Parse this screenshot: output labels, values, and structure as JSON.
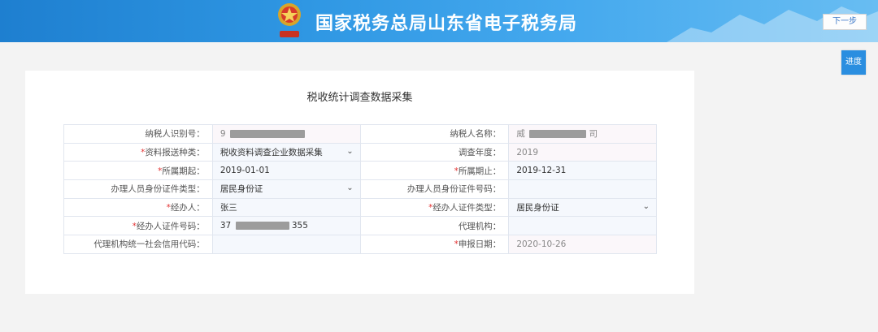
{
  "header": {
    "site_title": "国家税务总局山东省电子税务局",
    "next_label": "下一步"
  },
  "side": {
    "progress_label": "进度"
  },
  "form": {
    "title": "税收统计调查数据采集",
    "rows": [
      {
        "l1": "纳税人识别号：",
        "v1": "9",
        "l2": "纳税人名称：",
        "v2": "威",
        "v2_suffix": "司"
      },
      {
        "l1": "资料报送种类：",
        "v1": "税收资料调查企业数据采集",
        "l2": "调查年度：",
        "v2": "2019"
      },
      {
        "l1": "所属期起：",
        "v1": "2019-01-01",
        "l2": "所属期止：",
        "v2": "2019-12-31"
      },
      {
        "l1": "办理人员身份证件类型：",
        "v1": "居民身份证",
        "l2": "办理人员身份证件号码：",
        "v2": ""
      },
      {
        "l1": "经办人：",
        "v1": "张三",
        "l2": "经办人证件类型：",
        "v2": "居民身份证"
      },
      {
        "l1": "经办人证件号码：",
        "v1": "37",
        "v1_suffix": "355",
        "l2": "代理机构：",
        "v2": ""
      },
      {
        "l1": "代理机构统一社会信用代码：",
        "v1": "",
        "l2": "申报日期：",
        "v2": "2020-10-26"
      }
    ]
  },
  "icons": {
    "emblem": "tax-emblem-icon",
    "dropdown": "chevron-down-icon"
  },
  "colors": {
    "header_blue": "#2f97e3",
    "required": "#e33333",
    "button_blue": "#2a8ee0"
  }
}
